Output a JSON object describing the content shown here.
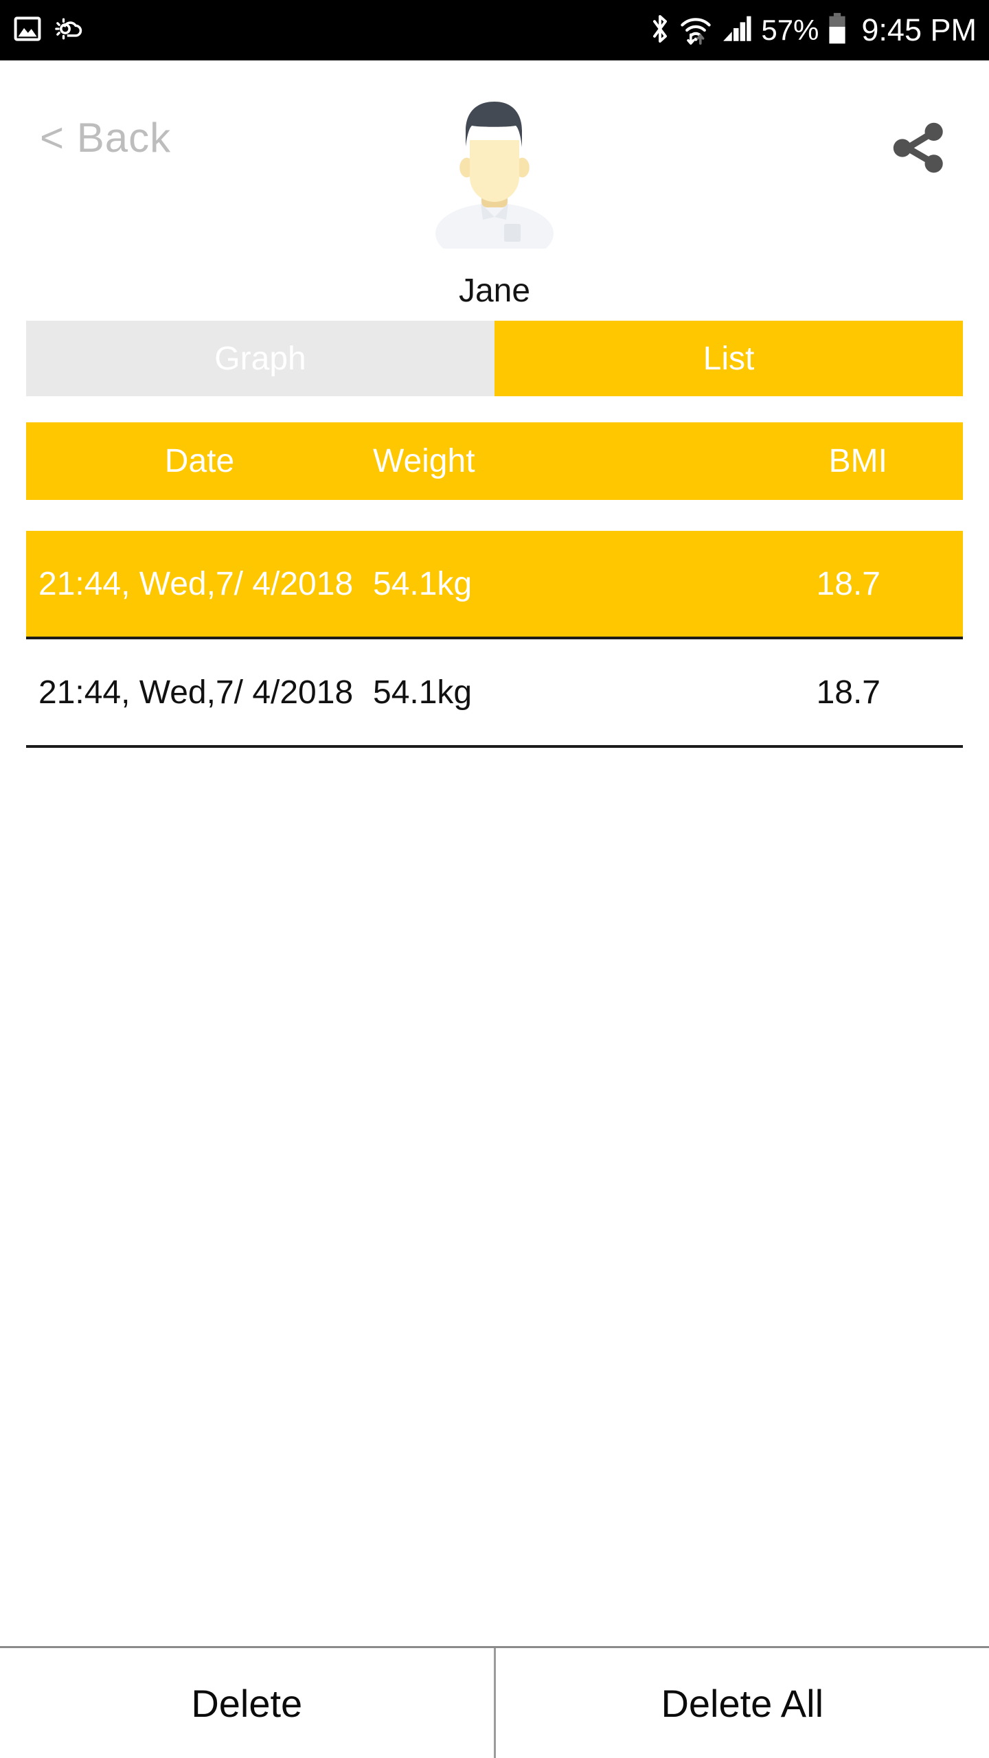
{
  "status_bar": {
    "left_icons": [
      "image-icon",
      "weather-partly-cloudy-icon"
    ],
    "right_icons": [
      "bluetooth-icon",
      "wifi-icon",
      "cellular-signal-icon",
      "battery-icon"
    ],
    "battery_percent": "57%",
    "time": "9:45 PM",
    "background_color": "#000000",
    "foreground_color": "#ffffff"
  },
  "header": {
    "back_label": "< Back",
    "share_icon": "share-icon",
    "avatar_icon": "user-avatar-icon",
    "profile_name": "Jane"
  },
  "tabs": {
    "items": [
      {
        "label": "Graph",
        "selected": false
      },
      {
        "label": "List",
        "selected": true
      }
    ]
  },
  "table": {
    "columns": [
      "Date",
      "Weight",
      "BMI"
    ],
    "rows": [
      {
        "date": "21:44, Wed,7/ 4/2018",
        "weight": "54.1kg",
        "bmi": "18.7",
        "selected": true
      },
      {
        "date": "21:44, Wed,7/ 4/2018",
        "weight": "54.1kg",
        "bmi": "18.7",
        "selected": false
      }
    ]
  },
  "bottom_bar": {
    "delete_label": "Delete",
    "delete_all_label": "Delete All"
  },
  "colors": {
    "accent_amber": "#fec700",
    "inactive_tab_gray": "#e9e9e9",
    "back_gray": "#bdbdbd",
    "share_gray": "#525252"
  }
}
